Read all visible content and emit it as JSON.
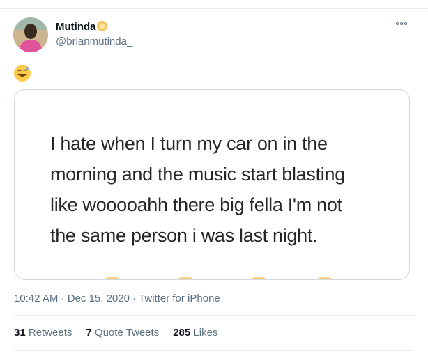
{
  "author": {
    "name": "Mutinda",
    "handle": "@brianmutinda_"
  },
  "tweet": {
    "emoji_icon": "sweat-smile-emoji",
    "image_text_lines": [
      "I hate when I turn my car on in the",
      "morning and the music start blasting",
      "like wooooahh there big fella I'm not",
      "the same person i was last night."
    ]
  },
  "meta": {
    "time": "10:42 AM",
    "separator": "·",
    "date": "Dec 15, 2020",
    "source": "Twitter for iPhone"
  },
  "stats": {
    "retweets_count": "31",
    "retweets_label": "Retweets",
    "quote_count": "7",
    "quote_label": "Quote Tweets",
    "likes_count": "285",
    "likes_label": "Likes"
  },
  "colors": {
    "secondary_text": "#5b7083",
    "border": "#cfd9de"
  }
}
